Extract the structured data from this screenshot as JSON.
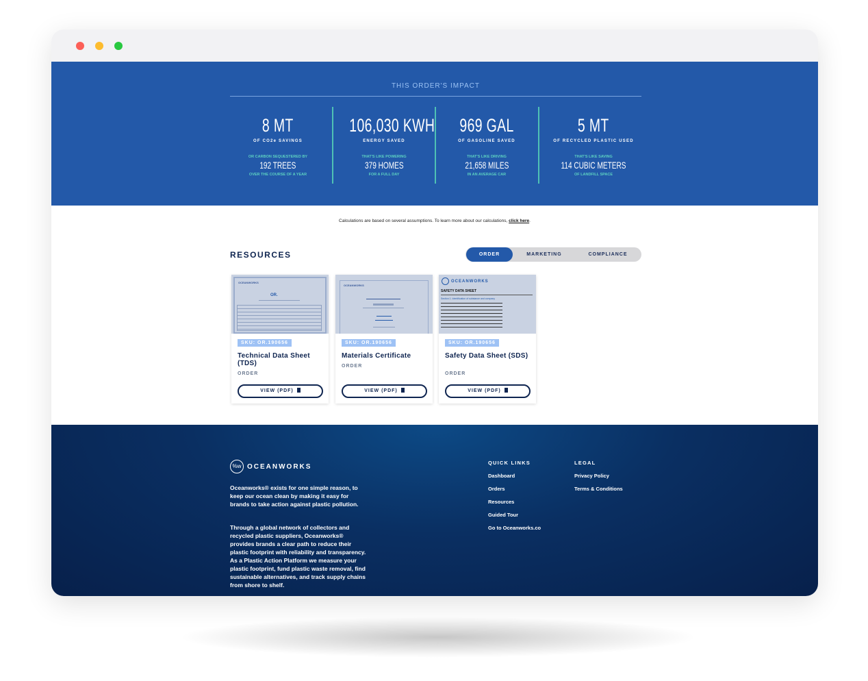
{
  "impact": {
    "title": "THIS ORDER'S IMPACT",
    "stats": [
      {
        "value": "8 MT",
        "label": "OF CO2e SAVINGS",
        "pre": "OR CARBON SEQUESTERED BY",
        "equiv": "192 TREES",
        "post": "OVER THE COURSE OF A YEAR"
      },
      {
        "value": "106,030 KWH",
        "label": "ENERGY SAVED",
        "pre": "THAT'S LIKE POWERING",
        "equiv": "379 HOMES",
        "post": "FOR A FULL DAY"
      },
      {
        "value": "969 GAL",
        "label": "OF GASOLINE SAVED",
        "pre": "THAT'S LIKE DRIVING",
        "equiv": "21,658 MILES",
        "post": "IN AN AVERAGE CAR"
      },
      {
        "value": "5 MT",
        "label": "OF RECYCLED PLASTIC USED",
        "pre": "THAT'S LIKE SAVING",
        "equiv": "114 CUBIC METERS",
        "post": "OF LANDFILL SPACE"
      }
    ]
  },
  "note": {
    "text": "Calculations are based on several assumptions. To learn more about our calculations, ",
    "link": "click here",
    "end": "."
  },
  "resources": {
    "title": "RESOURCES",
    "tabs": [
      "ORDER",
      "MARKETING",
      "COMPLIANCE"
    ],
    "cards": [
      {
        "sku": "SKU: OR.190656",
        "title": "Technical Data Sheet (TDS)",
        "type": "ORDER",
        "button": "VIEW (PDF)"
      },
      {
        "sku": "SKU: OR.190656",
        "title": "Materials Certificate",
        "type": "ORDER",
        "button": "VIEW (PDF)"
      },
      {
        "sku": "SKU: OR.190656",
        "title": "Safety Data Sheet (SDS)",
        "type": "ORDER",
        "button": "VIEW (PDF)"
      }
    ],
    "thumb_texts": {
      "brand": "OCEANWORKS",
      "sds_title": "SAFETY DATA SHEET",
      "sds_section": "Section 1. Identification of substance and company",
      "tds_code": "OR."
    }
  },
  "footer": {
    "brand": "OCEANWORKS",
    "logo_mark": "%w",
    "para1": "Oceanworks® exists for one simple reason, to keep our ocean clean by making it easy for brands to take action against plastic pollution.",
    "para2": "Through a global network of collectors and recycled plastic suppliers, Oceanworks® provides brands a clear path to reduce their plastic footprint with reliability and transparency. As a Plastic Action Platform we measure your plastic footprint, fund plastic waste removal, find sustainable alternatives, and track supply chains from shore to shelf.",
    "quick_links_title": "QUICK LINKS",
    "quick_links": [
      "Dashboard",
      "Orders",
      "Resources",
      "Guided Tour",
      "Go to Oceanworks.co"
    ],
    "legal_title": "LEGAL",
    "legal": [
      "Privacy Policy",
      "Terms & Conditions"
    ]
  }
}
